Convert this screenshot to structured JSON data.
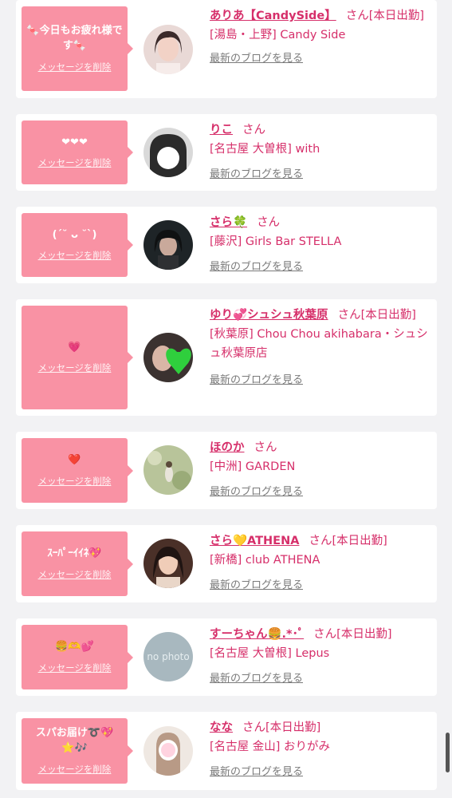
{
  "common": {
    "delete_label": "メッセージを削除",
    "blog_label": "最新のブログを見る",
    "san": "さん"
  },
  "items": [
    {
      "message": "🍬今日もお疲れ様です🍬",
      "name": "ありあ【CandySide】",
      "status": "[本日出勤]",
      "shop": "[湯島・上野] Candy Side",
      "avatar": "portrait-photo"
    },
    {
      "message": "❤❤❤",
      "name": "りこ",
      "status": "",
      "shop": "[名古屋 大曽根] with",
      "avatar": "portrait-photo"
    },
    {
      "message": "(ˊ˘ ᴗ ˘ˋ)",
      "name": "さら🍀",
      "status": "",
      "shop": "[藤沢] Girls Bar STELLA",
      "avatar": "portrait-photo"
    },
    {
      "message": "💗",
      "name": "ゆり💞シュシュ秋葉原",
      "status": "[本日出勤]",
      "shop": "[秋葉原] Chou Chou akihabara・シュシュ秋葉原店",
      "avatar": "portrait-photo"
    },
    {
      "message": "❤️",
      "name": "ほのか",
      "status": "",
      "shop": "[中洲] GARDEN",
      "avatar": "portrait-photo"
    },
    {
      "message": "ｽｰﾊﾟｰｲｲﾈ💖",
      "name": "さら💛ATHENA",
      "status": "[本日出勤]",
      "shop": "[新橋] club ATHENA",
      "avatar": "portrait-photo"
    },
    {
      "message": "🍔🫶💕",
      "name": "すーちゃん🍔.*･ﾟ",
      "status": "[本日出勤]",
      "shop": "[名古屋 大曽根] Lepus",
      "avatar": "no photo"
    },
    {
      "message": "スパお届け➰💖⭐️🎶",
      "name": "なな",
      "status": "[本日出勤]",
      "shop": "[名古屋 金山] おりがみ",
      "avatar": "portrait-photo"
    }
  ]
}
